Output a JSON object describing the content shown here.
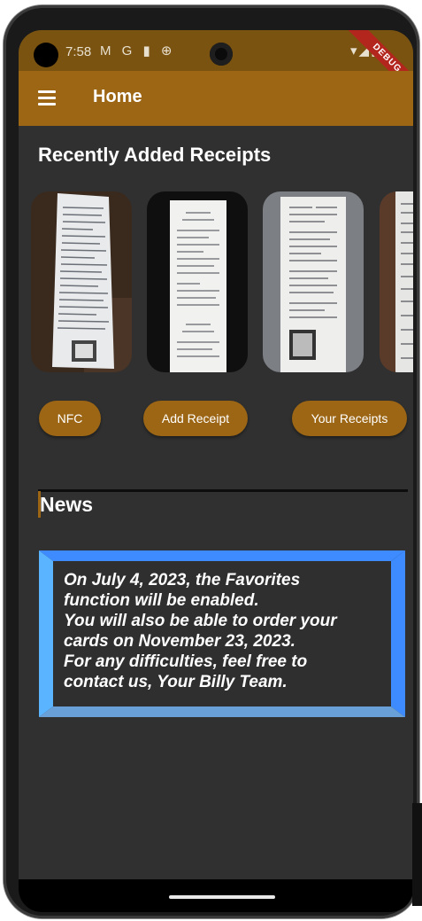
{
  "status_bar": {
    "time": "7:58",
    "left_icons": "M G ▮ ⊕",
    "right_icons": "▾◢▮",
    "debug_label": "DEBUG"
  },
  "app_bar": {
    "menu_icon": "hamburger-menu-icon",
    "title": "Home"
  },
  "recent": {
    "title": "Recently Added Receipts",
    "receipt_images": [
      "receipt-photo",
      "receipt-photo",
      "receipt-photo",
      "receipt-photo"
    ]
  },
  "actions": {
    "nfc": "NFC",
    "add_receipt": "Add Receipt",
    "your_receipts": "Your Receipts"
  },
  "news": {
    "title": "News",
    "message": "On July 4, 2023, the Favorites function will be enabled. You will also be able to order your cards on November 23, 2023. For any difficulties, feel free to contact us, Your Billy Team.",
    "lines": [
      "On July 4, 2023, the Favorites",
      "function will be enabled.",
      "You will also be able to order your",
      "cards on November 23, 2023.",
      "For any difficulties, feel free to",
      "contact us, Your Billy Team."
    ]
  },
  "colors": {
    "primary": "#9c6614",
    "status_bar": "#7a5310",
    "background": "#303030",
    "news_border_blue": "#3d8bff",
    "news_border_light": "#5ab4ff"
  }
}
